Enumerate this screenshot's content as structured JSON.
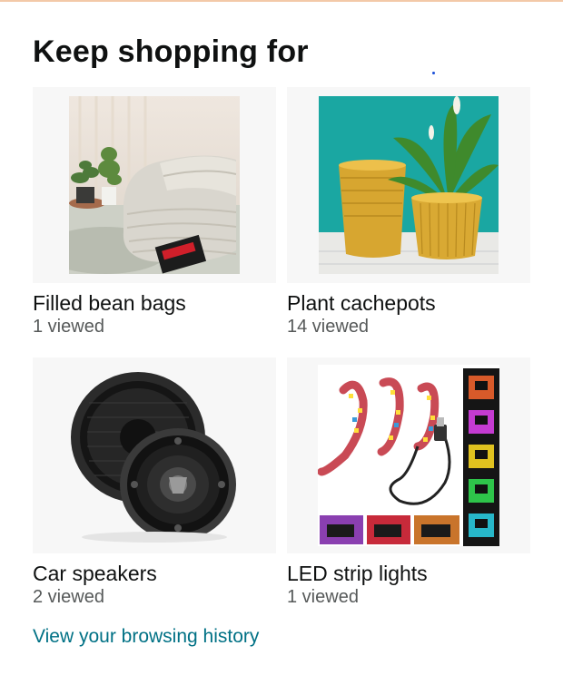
{
  "section": {
    "title": "Keep shopping for",
    "history_link": "View your browsing history"
  },
  "cards": [
    {
      "label": "Filled bean bags",
      "count": "1 viewed",
      "icon": "bean-bag-image"
    },
    {
      "label": "Plant cachepots",
      "count": "14 viewed",
      "icon": "plant-pot-image"
    },
    {
      "label": "Car speakers",
      "count": "2 viewed",
      "icon": "car-speaker-image"
    },
    {
      "label": "LED strip lights",
      "count": "1 viewed",
      "icon": "led-strip-image"
    }
  ],
  "colors": {
    "link": "#007185",
    "muted_text": "#565959",
    "tile_background": "#f7f7f7"
  }
}
